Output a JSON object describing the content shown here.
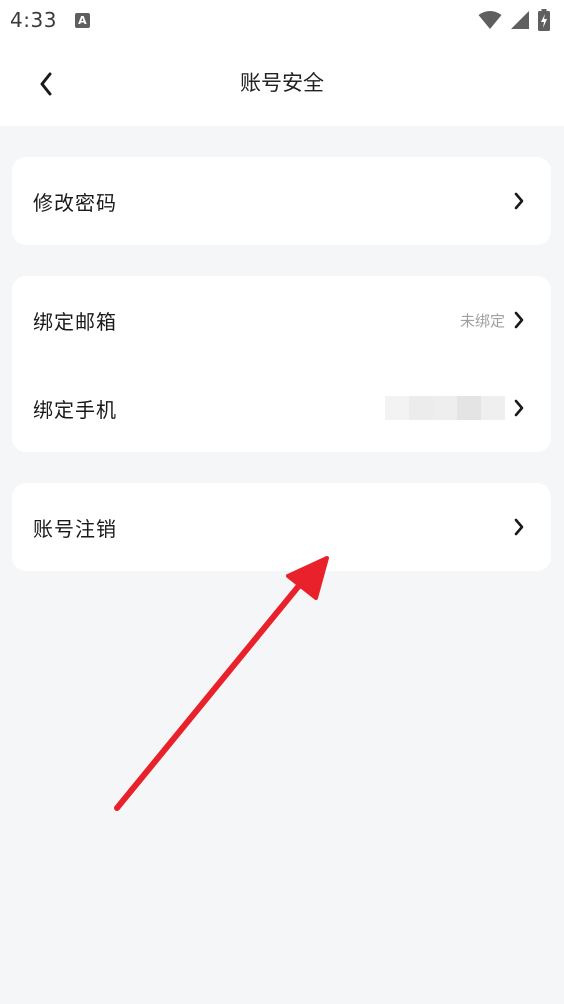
{
  "status_bar": {
    "time": "4:33",
    "notification_glyph": "A",
    "icons": [
      "wifi-icon",
      "signal-icon",
      "battery-charging-icon"
    ]
  },
  "header": {
    "title": "账号安全",
    "back_icon": "chevron-left-icon"
  },
  "settings": {
    "change_password": {
      "label": "修改密码"
    },
    "bind_email": {
      "label": "绑定邮箱",
      "value": "未绑定"
    },
    "bind_phone": {
      "label": "绑定手机",
      "value_state": "blurred"
    },
    "delete_account": {
      "label": "账号注销"
    }
  },
  "colors": {
    "background": "#f5f6f8",
    "card": "#ffffff",
    "annotation_arrow": "#e8212b",
    "secondary_text": "#a0a0a0"
  }
}
